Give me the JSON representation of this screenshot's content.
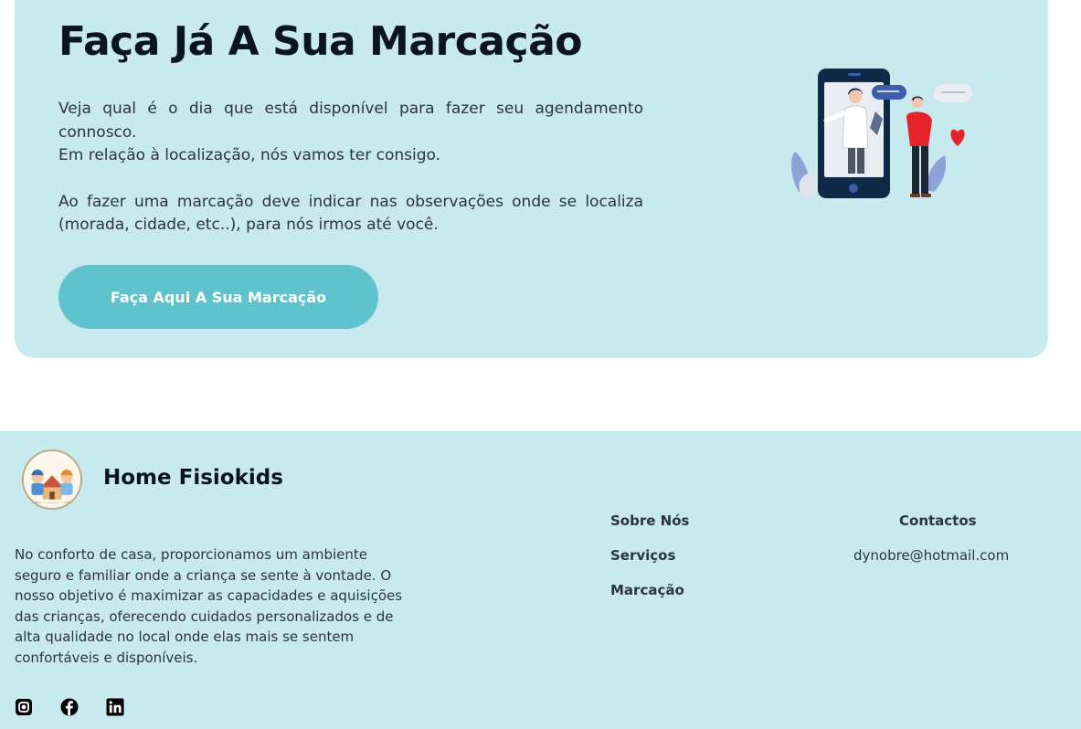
{
  "cta": {
    "title": "Faça Já A Sua Marcação",
    "line1": "Veja qual é o dia que está disponível para fazer seu agendamento connosco.",
    "line2": "Em relação à localização, nós vamos ter consigo.",
    "line3": "Ao fazer uma marcação deve indicar nas observações onde se localiza (morada, cidade, etc..), para nós irmos até você.",
    "button_label": "Faça Aqui A Sua Marcação",
    "illustration_icon": "doctor-video-call-illustration"
  },
  "footer": {
    "brand_name": "Home Fisiokids",
    "logo_icon": "kids-house-logo",
    "description": "No conforto de casa, proporcionamos um ambiente seguro e familiar onde a criança se sente à vontade. O nosso objetivo é maximizar as capacidades e aquisições das crianças, oferecendo cuidados personalizados e de alta qualidade no local onde elas mais se sentem confortáveis e disponíveis.",
    "nav": [
      "Sobre Nós",
      "Serviços",
      "Marcação"
    ],
    "contacts_heading": "Contactos",
    "email": "dynobre@hotmail.com",
    "social_icons": [
      "instagram-icon",
      "facebook-icon",
      "linkedin-icon"
    ]
  },
  "colors": {
    "card_background": "#c8e9ed",
    "button": "#5ec3cc",
    "title": "#0b1423",
    "text": "#2b3440"
  }
}
